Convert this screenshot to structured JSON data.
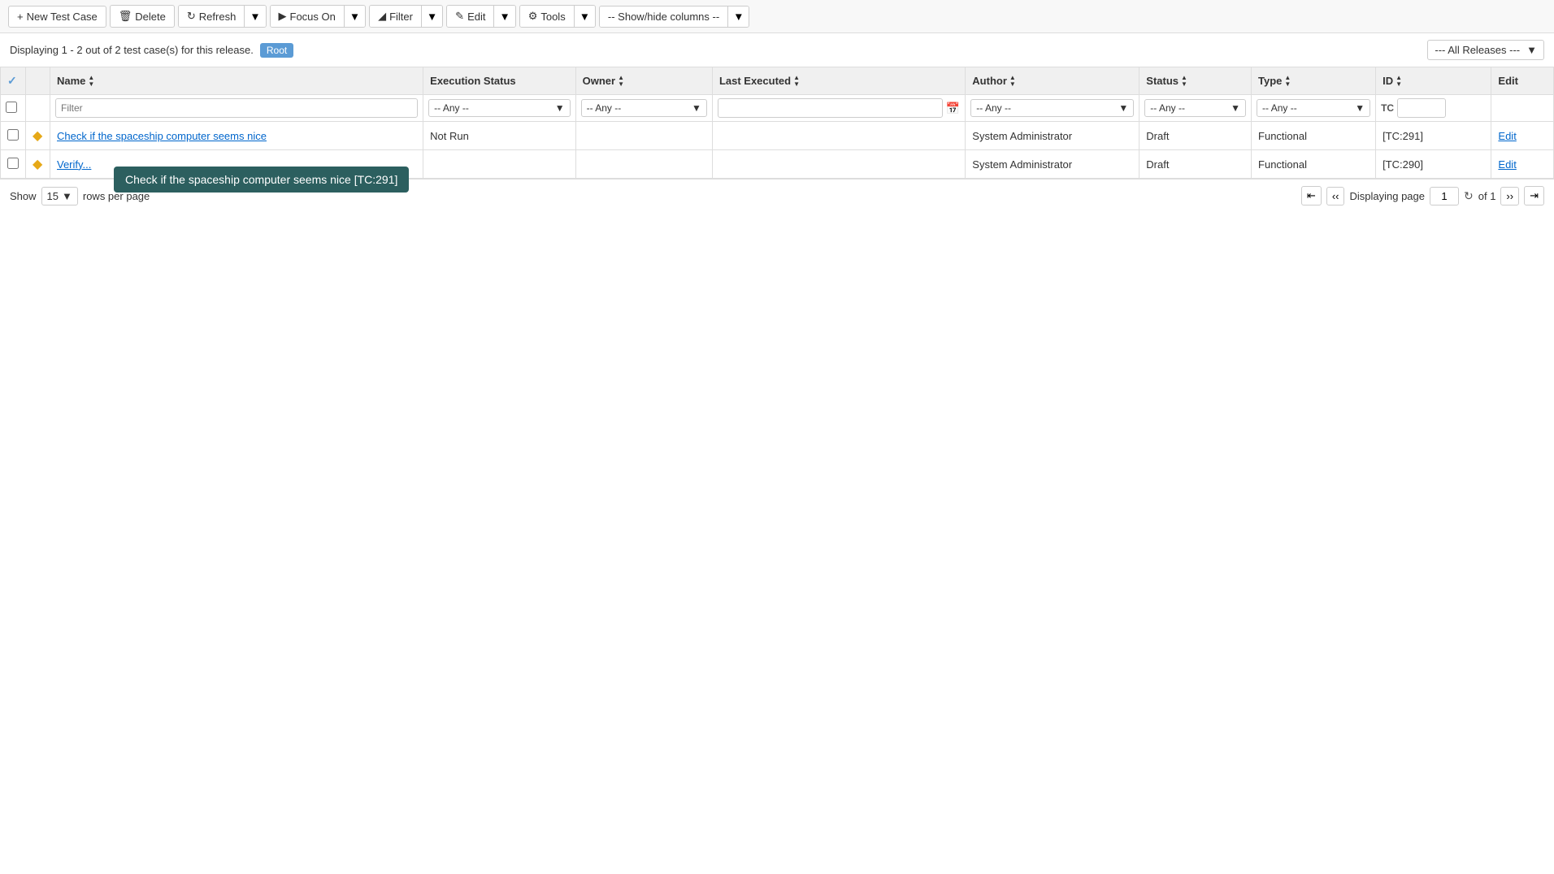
{
  "toolbar": {
    "new_test_case_label": "New Test Case",
    "delete_label": "Delete",
    "refresh_label": "Refresh",
    "focus_on_label": "Focus On",
    "filter_label": "Filter",
    "edit_label": "Edit",
    "tools_label": "Tools",
    "show_hide_label": "-- Show/hide columns --"
  },
  "info_bar": {
    "display_text": "Displaying 1 - 2 out of 2 test case(s) for this release.",
    "root_label": "Root",
    "releases_label": "--- All Releases ---"
  },
  "table": {
    "columns": [
      {
        "id": "cb",
        "label": ""
      },
      {
        "id": "check_all",
        "label": ""
      },
      {
        "id": "name",
        "label": "Name"
      },
      {
        "id": "execution_status",
        "label": "Execution Status"
      },
      {
        "id": "owner",
        "label": "Owner"
      },
      {
        "id": "last_executed",
        "label": "Last Executed"
      },
      {
        "id": "author",
        "label": "Author"
      },
      {
        "id": "status",
        "label": "Status"
      },
      {
        "id": "type",
        "label": "Type"
      },
      {
        "id": "id",
        "label": "ID"
      },
      {
        "id": "edit",
        "label": "Edit"
      }
    ],
    "filter_row": {
      "name_placeholder": "Filter",
      "execution_any": "-- Any --",
      "owner_any": "-- Any --",
      "author_any": "-- Any --",
      "status_any": "-- Any --",
      "type_any": "-- Any --",
      "id_prefix": "TC"
    },
    "rows": [
      {
        "id": 1,
        "name": "Check if the spaceship computer seems nice",
        "execution_status": "Not Run",
        "owner": "",
        "last_executed": "",
        "author": "System Administrator",
        "status": "Draft",
        "type": "Functional",
        "tc_id": "[TC:291]",
        "edit_label": "Edit"
      },
      {
        "id": 2,
        "name": "Verify...",
        "execution_status": "",
        "owner": "",
        "last_executed": "",
        "author": "System Administrator",
        "status": "Draft",
        "type": "Functional",
        "tc_id": "[TC:290]",
        "edit_label": "Edit"
      }
    ]
  },
  "tooltip": {
    "text": "Check if the spaceship computer seems nice [TC:291]"
  },
  "pagination": {
    "show_label": "Show",
    "page_size": "15",
    "rows_per_page_label": "rows per page",
    "displaying_page_label": "Displaying page",
    "page_current": "1",
    "of_label": "of 1"
  }
}
